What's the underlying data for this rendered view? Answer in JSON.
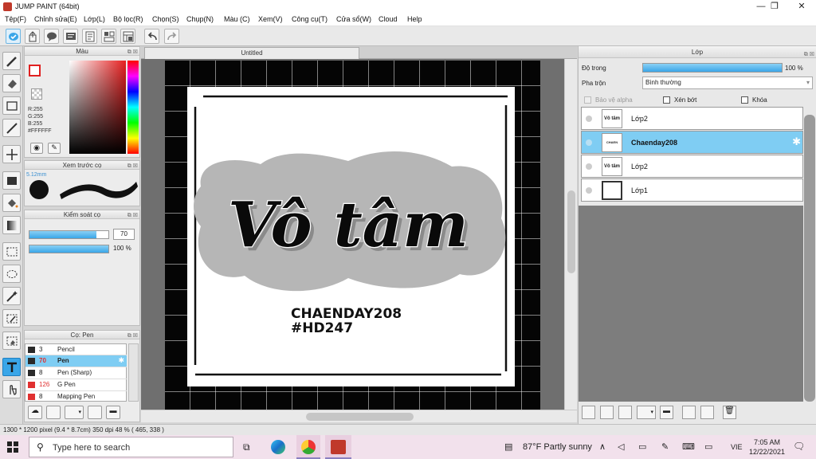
{
  "window": {
    "title": "JUMP PAINT (64bit)",
    "minimize": "—",
    "maximize": "❐",
    "close": "✕"
  },
  "menu": [
    "Tệp(F)",
    "Chỉnh sửa(E)",
    "Lớp(L)",
    "Bộ lọc(R)",
    "Chọn(S)",
    "Chụp(N)",
    "Màu (C)",
    "Xem(V)",
    "Công cụ(T)",
    "Cửa sổ(W)",
    "Cloud",
    "Help"
  ],
  "color_panel": {
    "title": "Màu",
    "r": "R:255",
    "g": "G:255",
    "b": "B:255",
    "hex": "#FFFFFF"
  },
  "brush_preview": {
    "title": "Xem trước cọ",
    "size": "5.12mm"
  },
  "brush_control": {
    "title": "Kiểm soát cọ",
    "size_value": "70",
    "opacity_value": "100 %",
    "size_fraction": 0.85,
    "opacity_fraction": 1.0
  },
  "brush_list": {
    "title": "Cọ: Pen",
    "items": [
      {
        "size": "3",
        "name": "Pencil",
        "color": "#2a2a2a"
      },
      {
        "size": "70",
        "name": "Pen",
        "color": "#2a2a2a"
      },
      {
        "size": "8",
        "name": "Pen (Sharp)",
        "color": "#2a2a2a"
      },
      {
        "size": "126",
        "name": "G Pen",
        "color": "#e03030"
      },
      {
        "size": "8",
        "name": "Mapping Pen",
        "color": "#e03030"
      }
    ]
  },
  "canvas": {
    "tab": "Untitled",
    "main_text": "Vô tâm",
    "sub_line1": "CHAENDAY208",
    "sub_line2": "#HD247"
  },
  "layer_panel": {
    "title": "Lớp",
    "opacity_label": "Độ trong",
    "opacity_value": "100 %",
    "blend_label": "Pha trộn",
    "blend_value": "Bình thường",
    "protect_alpha": "Bảo vệ alpha",
    "clipping": "Xén bớt",
    "lock": "Khóa",
    "layers": [
      {
        "name": "Lớp2",
        "thumb": "Vô tâm"
      },
      {
        "name": "Chaenday208",
        "thumb": "CHAEN"
      },
      {
        "name": "Lớp2",
        "thumb": "Vô tâm"
      },
      {
        "name": "Lớp1",
        "thumb": ""
      }
    ]
  },
  "status": {
    "text": "1300 * 1200 pixel  (9.4 * 8.7cm)  350 dpi  48 %  ( 465, 338 )"
  },
  "taskbar": {
    "search_placeholder": "Type here to search",
    "weather": "87°F  Partly sunny",
    "lang": "VIE",
    "time": "7:05 AM",
    "date": "12/22/2021"
  },
  "colors": {
    "accent": "#3aa6e8",
    "selected_layer": "#7fcdf3",
    "taskbar": "#f2e1ec"
  }
}
